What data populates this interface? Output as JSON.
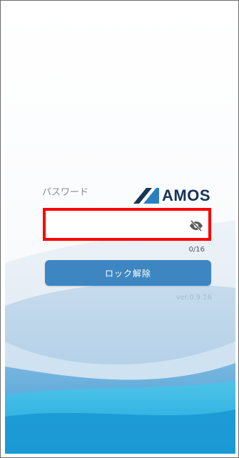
{
  "app": {
    "logo_text": "AMOS",
    "password_label": "パスワード",
    "password_value": "",
    "password_icon": "eye-slash-icon",
    "char_counter": "0/16",
    "unlock_label": "ロック解除",
    "version": "ver.0.9.16"
  },
  "colors": {
    "brand_navy": "#173457",
    "button": "#3e86c2",
    "highlight_border": "#ff0000",
    "wave_blue": "#1e8fd0"
  }
}
